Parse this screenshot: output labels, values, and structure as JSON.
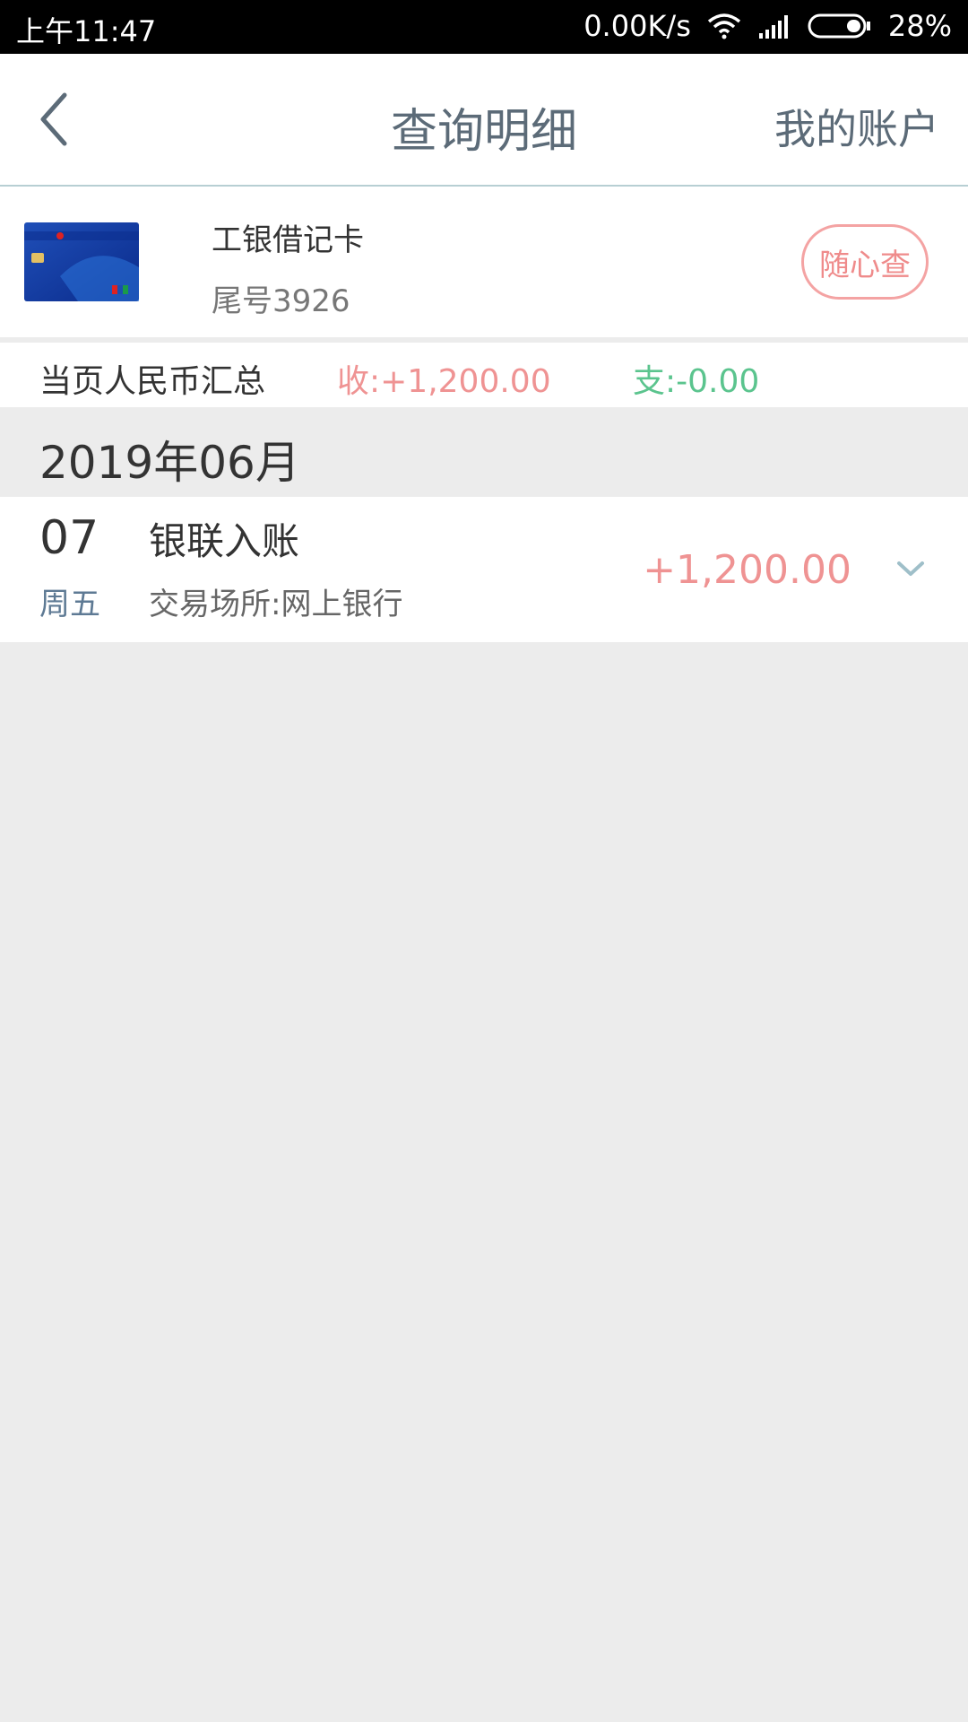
{
  "status_bar": {
    "time": "上午11:47",
    "net_speed": "0.00K/s",
    "battery": "28%"
  },
  "nav": {
    "title": "查询明细",
    "right_label": "我的账户"
  },
  "card": {
    "name": "工银借记卡",
    "tail": "尾号3926",
    "quick_button": "随心查"
  },
  "summary": {
    "label": "当页人民币汇总",
    "income": "收:+1,200.00",
    "expense": "支:-0.00"
  },
  "month": "2019年06月",
  "transactions": [
    {
      "day": "07",
      "weekday": "周五",
      "description": "银联入账",
      "place": "交易场所:网上银行",
      "amount": "+1,200.00"
    }
  ],
  "colors": {
    "income": "#ef9393",
    "expense": "#5bc48e",
    "nav_text": "#5c6b78",
    "background": "#ececec"
  }
}
